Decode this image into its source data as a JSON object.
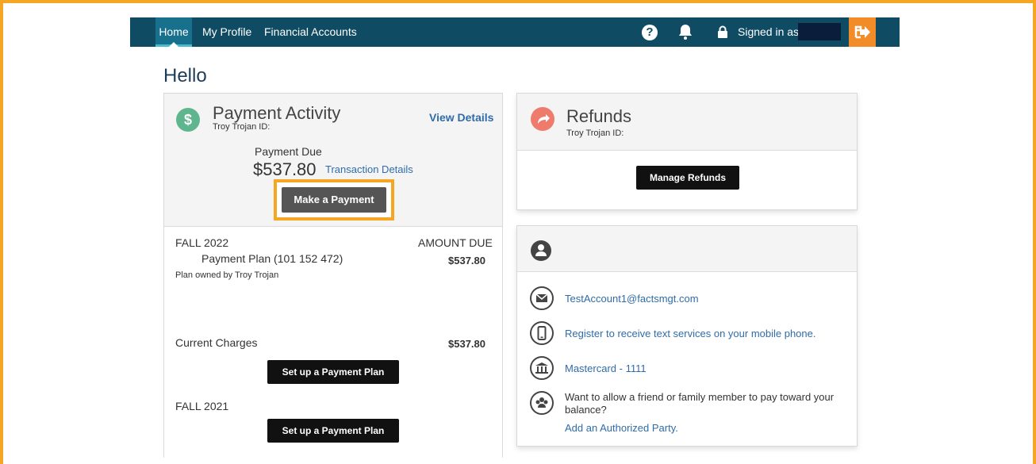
{
  "nav": {
    "tabs": [
      {
        "label": "Home",
        "active": true
      },
      {
        "label": "My Profile",
        "active": false
      },
      {
        "label": "Financial Accounts",
        "active": false
      }
    ],
    "help_label": "?",
    "signed_in_label": "Signed in as"
  },
  "greeting": "Hello",
  "payment_activity": {
    "title": "Payment Activity",
    "student_id_label": "Troy Trojan ID:",
    "view_details": "View Details",
    "payment_due_label": "Payment Due",
    "payment_due_amount": "$537.80",
    "transaction_details": "Transaction Details",
    "make_payment": "Make a Payment",
    "term1": "FALL 2022",
    "amount_due_header": "AMOUNT DUE",
    "plan_name": "Payment Plan (101 152 472)",
    "plan_amount": "$537.80",
    "plan_owner": "Plan owned by Troy Trojan",
    "current_charges_label": "Current Charges",
    "current_charges_amount": "$537.80",
    "setup_plan_1": "Set up a Payment Plan",
    "term2": "FALL 2021",
    "setup_plan_2": "Set up a Payment Plan"
  },
  "refunds": {
    "title": "Refunds",
    "student_id_label": "Troy Trojan ID:",
    "manage_refunds": "Manage Refunds"
  },
  "contact": {
    "email": "TestAccount1@factsmgt.com",
    "text_services": "Register to receive text services on your mobile phone.",
    "bank": "Mastercard - 1111",
    "authorized_prompt": "Want to allow a friend or family member to pay toward your balance?",
    "authorized_link": "Add an Authorized Party."
  },
  "colors": {
    "nav_bg": "#0f4b63",
    "highlight": "#f5a623",
    "link": "#2f6ca9",
    "dollar_icon": "#5fb58e",
    "refund_icon": "#ee7b6c",
    "signout": "#f28c28"
  }
}
